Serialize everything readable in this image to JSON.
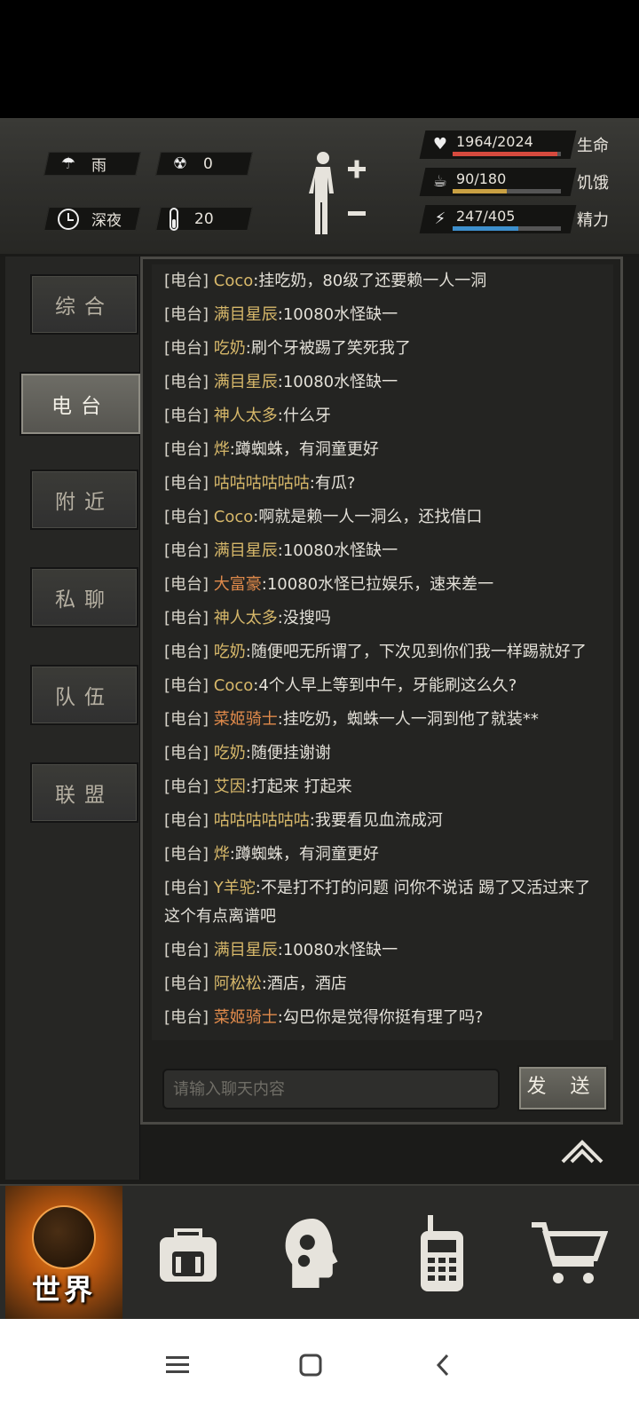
{
  "status": {
    "weather": "雨",
    "radiation": "0",
    "time_of_day": "深夜",
    "temperature": "20",
    "bars": [
      {
        "icon": "heart-icon",
        "value": "1964/2024",
        "label": "生命",
        "fraction": 0.97,
        "color": "#d64a3e"
      },
      {
        "icon": "stomach-icon",
        "value": "90/180",
        "label": "饥饿",
        "fraction": 0.5,
        "color": "#c9a043"
      },
      {
        "icon": "energy-icon",
        "value": "247/405",
        "label": "精力",
        "fraction": 0.61,
        "color": "#3d8fcc"
      }
    ]
  },
  "tabs": [
    {
      "label": "综合",
      "active": false
    },
    {
      "label": "电台",
      "active": true
    },
    {
      "label": "附近",
      "active": false
    },
    {
      "label": "私聊",
      "active": false
    },
    {
      "label": "队伍",
      "active": false
    },
    {
      "label": "联盟",
      "active": false
    }
  ],
  "chat": {
    "channel": "[电台]",
    "messages": [
      {
        "name": "Coco",
        "text": ":挂吃奶，80级了还要赖一人一洞",
        "orange": false
      },
      {
        "name": "满目星辰",
        "text": ":10080水怪缺一",
        "orange": false
      },
      {
        "name": "吃奶",
        "text": ":刷个牙被踢了笑死我了",
        "orange": false
      },
      {
        "name": "满目星辰",
        "text": ":10080水怪缺一",
        "orange": false
      },
      {
        "name": "神人太多",
        "text": ":什么牙",
        "orange": false
      },
      {
        "name": "烨",
        "text": ":蹲蜘蛛，有洞童更好",
        "orange": false
      },
      {
        "name": "咕咕咕咕咕咕",
        "text": ":有瓜?",
        "orange": false
      },
      {
        "name": "Coco",
        "text": ":啊就是赖一人一洞么，还找借口",
        "orange": false
      },
      {
        "name": "满目星辰",
        "text": ":10080水怪缺一",
        "orange": false
      },
      {
        "name": "大富豪",
        "text": ":10080水怪已拉娱乐，速来差一",
        "orange": true
      },
      {
        "name": "神人太多",
        "text": ":没搜吗",
        "orange": false
      },
      {
        "name": "吃奶",
        "text": ":随便吧无所谓了，下次见到你们我一样踢就好了",
        "orange": false
      },
      {
        "name": "Coco",
        "text": ":4个人早上等到中午，牙能刷这么久?",
        "orange": false
      },
      {
        "name": "菜姬骑士",
        "text": ":挂吃奶，蜘蛛一人一洞到他了就装**",
        "orange": true
      },
      {
        "name": "吃奶",
        "text": ":随便挂谢谢",
        "orange": false
      },
      {
        "name": "艾因",
        "text": ":打起来 打起来",
        "orange": false
      },
      {
        "name": "咕咕咕咕咕咕",
        "text": ":我要看见血流成河",
        "orange": false
      },
      {
        "name": "烨",
        "text": ":蹲蜘蛛，有洞童更好",
        "orange": false
      },
      {
        "name": "Y羊驼",
        "text": ":不是打不打的问题 问你不说话 踢了又活过来了这个有点离谱吧",
        "orange": false
      },
      {
        "name": "满目星辰",
        "text": ":10080水怪缺一",
        "orange": false
      },
      {
        "name": "阿松松",
        "text": ":酒店，酒店",
        "orange": false
      },
      {
        "name": "菜姬骑士",
        "text": ":勾巴你是觉得你挺有理了吗?",
        "orange": true
      }
    ],
    "input_placeholder": "请输入聊天内容",
    "send_label": "发 送"
  },
  "bottom_nav": {
    "world_label": "世界",
    "items": [
      "backpack-icon",
      "head-gears-icon",
      "walkie-talkie-icon",
      "cart-icon"
    ]
  },
  "system_nav": [
    "menu-icon",
    "home-icon",
    "back-icon"
  ]
}
